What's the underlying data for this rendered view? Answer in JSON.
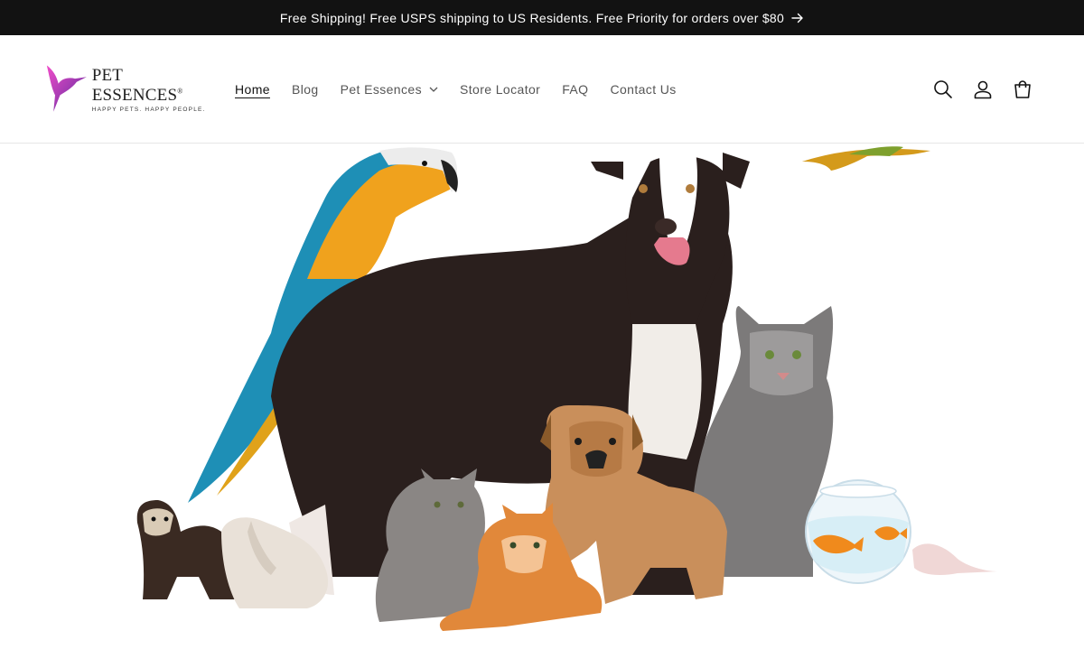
{
  "announcement": {
    "text": "Free Shipping! Free USPS shipping to US Residents. Free Priority for orders over $80",
    "icon": "arrow-right-icon"
  },
  "brand": {
    "name": "PET ESSENCES",
    "registered": "®",
    "tagline": "HAPPY PETS. HAPPY PEOPLE.",
    "logo_colors": [
      "#e040c8",
      "#8b3fd9",
      "#5b2a9e"
    ]
  },
  "nav": {
    "items": [
      {
        "label": "Home",
        "active": true
      },
      {
        "label": "Blog"
      },
      {
        "label": "Pet Essences",
        "has_dropdown": true
      },
      {
        "label": "Store Locator"
      },
      {
        "label": "FAQ"
      },
      {
        "label": "Contact Us"
      }
    ]
  },
  "header_icons": [
    "search-icon",
    "account-icon",
    "cart-icon"
  ],
  "hero": {
    "image": "group of pets: parrot, dog, cat, puppy, kittens, ferret, rabbit, fishbowl, mouse"
  }
}
